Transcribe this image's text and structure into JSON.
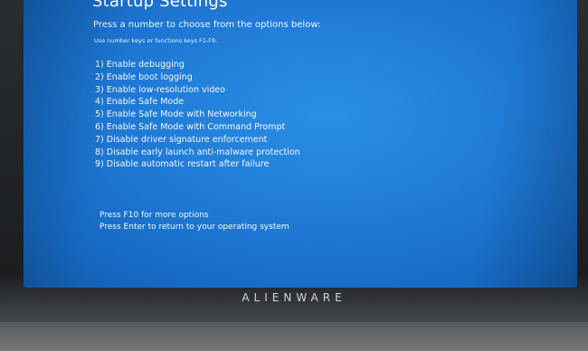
{
  "screen": {
    "title": "Startup Settings",
    "subtitle": "Press a number to choose from the options below:",
    "hint": "Use number keys or functions keys F1-F9.",
    "options": [
      "1) Enable debugging",
      "2) Enable boot logging",
      "3) Enable low-resolution video",
      "4) Enable Safe Mode",
      "5) Enable Safe Mode with Networking",
      "6) Enable Safe Mode with Command Prompt",
      "7) Disable driver signature enforcement",
      "8) Disable early launch anti-malware protection",
      "9) Disable automatic restart after failure"
    ],
    "more_options": "Press F10 for more options",
    "return_text": "Press Enter to return to your operating system"
  },
  "laptop": {
    "brand": "ALIENWARE"
  },
  "colors": {
    "screen_blue": "#1f7ad6",
    "text": "#ffffff",
    "bezel": "#1e2022"
  }
}
